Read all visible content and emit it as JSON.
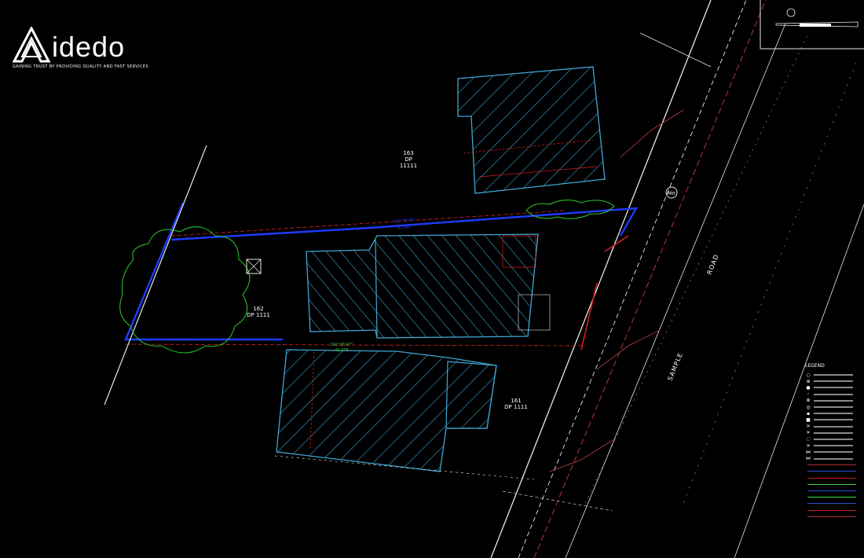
{
  "brand": {
    "name": "idedo",
    "tagline": "GAINING TRUST BY PROVIDING QUALITY AND FAST SERVICES"
  },
  "lots": {
    "north": {
      "lot": "163",
      "dp": "DP",
      "dp_num": "11111"
    },
    "subject": {
      "lot": "162",
      "dp": "DP 1111"
    },
    "south": {
      "lot": "161",
      "dp": "DP 1111"
    }
  },
  "road": {
    "word1": "SAMPLE",
    "word2": "ROAD"
  },
  "symbols": {
    "manhole": "MH"
  },
  "dimensions": {
    "north_boundary_bearing": "162°35'47\"",
    "north_boundary_distance": "42.895",
    "south_boundary_bearing": "342°35'47\"",
    "south_boundary_distance": "41.275"
  },
  "legend": {
    "title": "LEGEND",
    "symbol_items": [
      "○",
      "⊕",
      "●",
      "◦",
      "⊗",
      "◎",
      "▪",
      "■",
      "✕",
      "✕",
      "◌",
      "✕",
      "⋈",
      "⋈"
    ],
    "line_colors": [
      "#b03030",
      "#2a4fd0",
      "#d02020",
      "#3bd03b",
      "#2a4fd0",
      "#3bd03b",
      "#2a4fd0",
      "#d02020",
      "#b03030"
    ]
  },
  "colors": {
    "building_hatch": "#3fa7d6",
    "boundary": "#1e3cff",
    "survey_red": "#e02020",
    "vegetation": "#2ec82e",
    "road_line": "#c04040",
    "linework": "#e8e8e8"
  }
}
